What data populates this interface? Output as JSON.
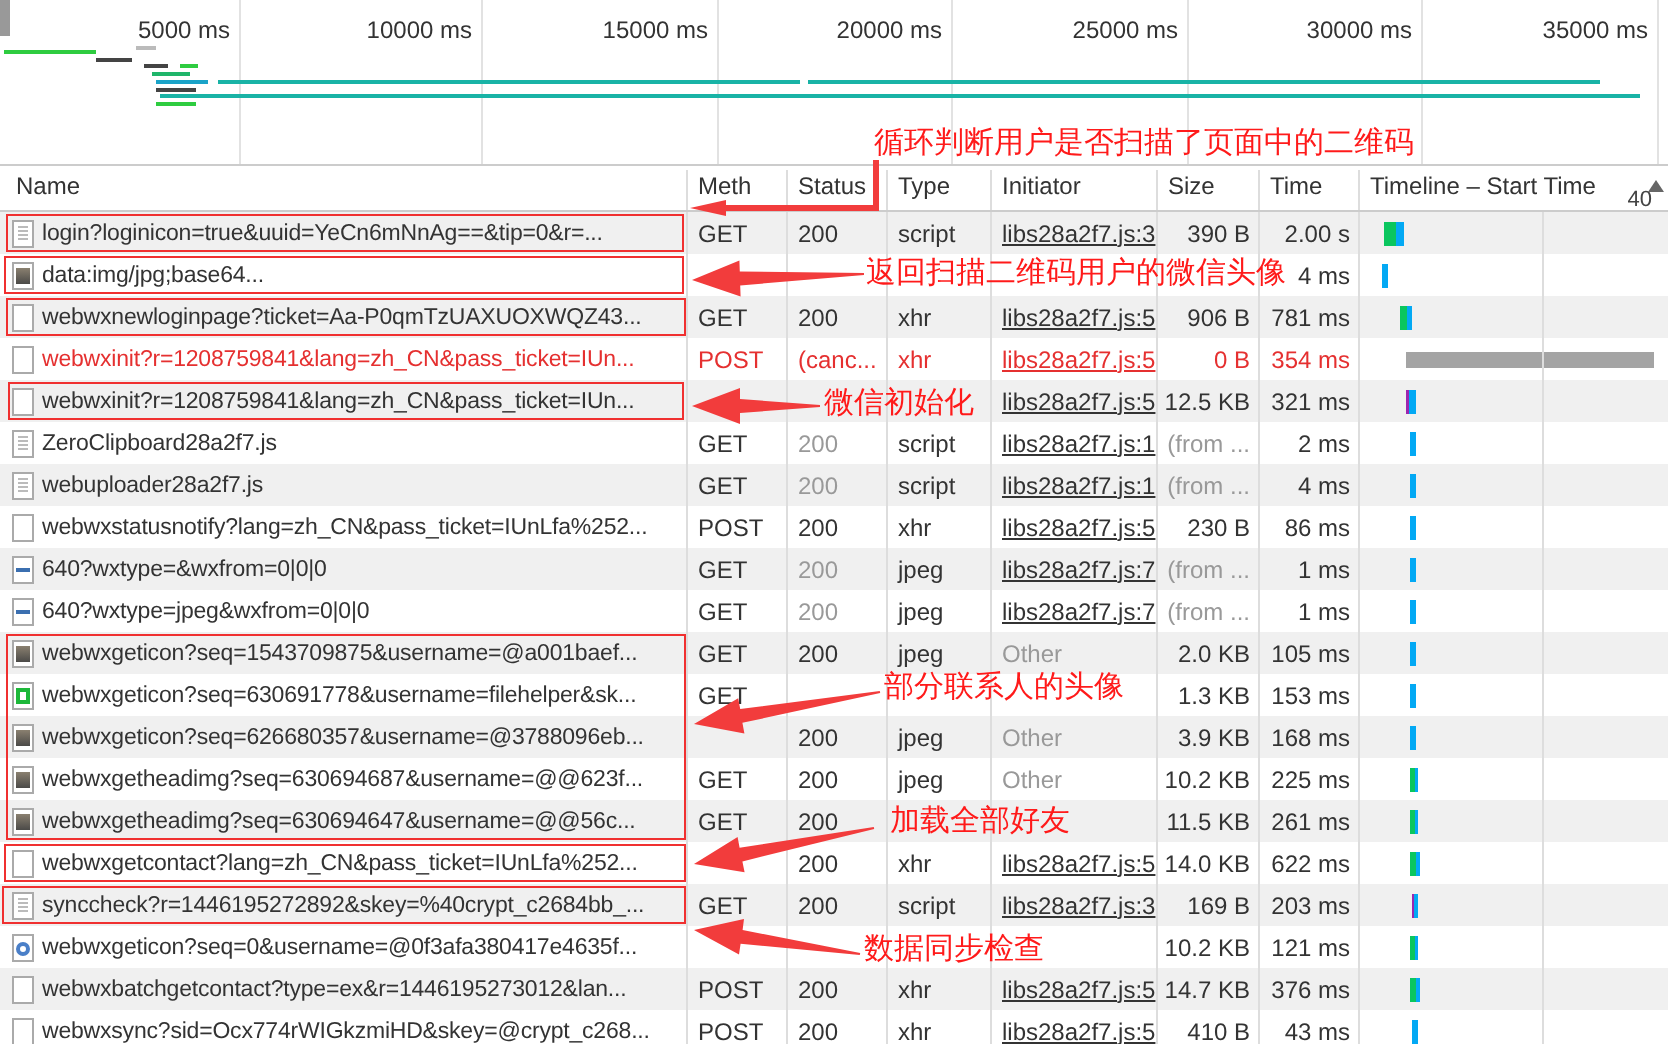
{
  "overview": {
    "ticks": [
      "5000 ms",
      "10000 ms",
      "15000 ms",
      "20000 ms",
      "25000 ms",
      "30000 ms",
      "35000 ms"
    ]
  },
  "columns": [
    {
      "label": "Name"
    },
    {
      "label": "Meth"
    },
    {
      "label": "Status"
    },
    {
      "label": "Type"
    },
    {
      "label": "Initiator"
    },
    {
      "label": "Size"
    },
    {
      "label": "Time"
    },
    {
      "label": "Timeline – Start Time"
    }
  ],
  "timeline_scale": "40",
  "rows": [
    {
      "kind": "lines",
      "name": "login?loginicon=true&uuid=YeCn6mNnAg==&tip=0&r=...",
      "method": "GET",
      "status": "200",
      "type": "script",
      "initiator": "libs28a2f7.js:3",
      "link": true,
      "size": "390 B",
      "time": "2.00 s",
      "failed": false,
      "cached": false
    },
    {
      "kind": "thumb",
      "name": "data:img/jpg;base64...",
      "time": "4 ms",
      "failed": false
    },
    {
      "kind": "blank",
      "name": "webwxnewloginpage?ticket=Aa-P0qmTzUAXUOXWQZ43...",
      "method": "GET",
      "status": "200",
      "type": "xhr",
      "initiator": "libs28a2f7.js:5",
      "link": true,
      "size": "906 B",
      "time": "781 ms",
      "failed": false,
      "cached": false
    },
    {
      "kind": "blank",
      "name": "webwxinit?r=1208759841&lang=zh_CN&pass_ticket=IUn...",
      "method": "POST",
      "status": "(canc...",
      "type": "xhr",
      "initiator": "libs28a2f7.js:5",
      "link": true,
      "size": "0 B",
      "time": "354 ms",
      "failed": true,
      "cached": false
    },
    {
      "kind": "blank",
      "name": "webwxinit?r=1208759841&lang=zh_CN&pass_ticket=IUn...",
      "initiator": "libs28a2f7.js:5",
      "link": true,
      "size": "12.5 KB",
      "time": "321 ms",
      "failed": false,
      "cached": false
    },
    {
      "kind": "lines",
      "name": "ZeroClipboard28a2f7.js",
      "method": "GET",
      "status": "200",
      "type": "script",
      "initiator": "libs28a2f7.js:1",
      "link": true,
      "size": "(from ...",
      "time": "2 ms",
      "failed": false,
      "cached": true
    },
    {
      "kind": "lines",
      "name": "webuploader28a2f7.js",
      "method": "GET",
      "status": "200",
      "type": "script",
      "initiator": "libs28a2f7.js:1",
      "link": true,
      "size": "(from ...",
      "time": "4 ms",
      "failed": false,
      "cached": true
    },
    {
      "kind": "blank",
      "name": "webwxstatusnotify?lang=zh_CN&pass_ticket=IUnLfa%252...",
      "method": "POST",
      "status": "200",
      "type": "xhr",
      "initiator": "libs28a2f7.js:5",
      "link": true,
      "size": "230 B",
      "time": "86 ms",
      "failed": false,
      "cached": false
    },
    {
      "kind": "strip",
      "name": "640?wxtype=&wxfrom=0|0|0",
      "method": "GET",
      "status": "200",
      "type": "jpeg",
      "initiator": "libs28a2f7.js:7",
      "link": true,
      "size": "(from ...",
      "time": "1 ms",
      "failed": false,
      "cached": true
    },
    {
      "kind": "strip",
      "name": "640?wxtype=jpeg&wxfrom=0|0|0",
      "method": "GET",
      "status": "200",
      "type": "jpeg",
      "initiator": "libs28a2f7.js:7",
      "link": true,
      "size": "(from ...",
      "time": "1 ms",
      "failed": false,
      "cached": true
    },
    {
      "kind": "thumb",
      "name": "webwxgeticon?seq=1543709875&username=@a001baef...",
      "method": "GET",
      "status": "200",
      "type": "jpeg",
      "initiator": "Other",
      "link": false,
      "size": "2.0 KB",
      "time": "105 ms",
      "failed": false,
      "cached": false
    },
    {
      "kind": "square",
      "name": "webwxgeticon?seq=630691778&username=filehelper&sk...",
      "method": "GET",
      "size": "1.3 KB",
      "time": "153 ms",
      "failed": false
    },
    {
      "kind": "thumb",
      "name": "webwxgeticon?seq=626680357&username=@3788096eb...",
      "status": "200",
      "type": "jpeg",
      "initiator": "Other",
      "link": false,
      "size": "3.9 KB",
      "time": "168 ms",
      "failed": false,
      "cached": false
    },
    {
      "kind": "thumb",
      "name": "webwxgetheadimg?seq=630694687&username=@@623f...",
      "method": "GET",
      "status": "200",
      "type": "jpeg",
      "initiator": "Other",
      "link": false,
      "size": "10.2 KB",
      "time": "225 ms",
      "failed": false,
      "cached": false
    },
    {
      "kind": "thumb",
      "name": "webwxgetheadimg?seq=630694647&username=@@56c...",
      "method": "GET",
      "status": "200",
      "size": "11.5 KB",
      "time": "261 ms",
      "failed": false,
      "cached": false
    },
    {
      "kind": "blank",
      "name": "webwxgetcontact?lang=zh_CN&pass_ticket=IUnLfa%252...",
      "status": "200",
      "type": "xhr",
      "initiator": "libs28a2f7.js:5",
      "link": true,
      "size": "14.0 KB",
      "time": "622 ms",
      "failed": false,
      "cached": false
    },
    {
      "kind": "lines",
      "name": "synccheck?r=1446195272892&skey=%40crypt_c2684bb_...",
      "method": "GET",
      "status": "200",
      "type": "script",
      "initiator": "libs28a2f7.js:3",
      "link": true,
      "size": "169 B",
      "time": "203 ms",
      "failed": false,
      "cached": false
    },
    {
      "kind": "target",
      "name": "webwxgeticon?seq=0&username=@0f3afa380417e4635f...",
      "size": "10.2 KB",
      "time": "121 ms",
      "failed": false
    },
    {
      "kind": "blank",
      "name": "webwxbatchgetcontact?type=ex&r=1446195273012&lan...",
      "method": "POST",
      "status": "200",
      "type": "xhr",
      "initiator": "libs28a2f7.js:5",
      "link": true,
      "size": "14.7 KB",
      "time": "376 ms",
      "failed": false,
      "cached": false
    },
    {
      "kind": "blank",
      "name": "webwxsync?sid=Ocx774rWIGkzmiHD&skey=@crypt_c268...",
      "method": "POST",
      "status": "200",
      "type": "xhr",
      "initiator": "libs28a2f7.js:5",
      "link": true,
      "size": "410 B",
      "time": "43 ms",
      "failed": false,
      "cached": false
    }
  ],
  "annotations": [
    {
      "text": "循环判断用户是否扫描了页面中的二维码"
    },
    {
      "text": "返回扫描二维码用户的微信头像"
    },
    {
      "text": "微信初始化"
    },
    {
      "text": "部分联系人的头像"
    },
    {
      "text": "加载全部好友"
    },
    {
      "text": "数据同步检查"
    }
  ]
}
